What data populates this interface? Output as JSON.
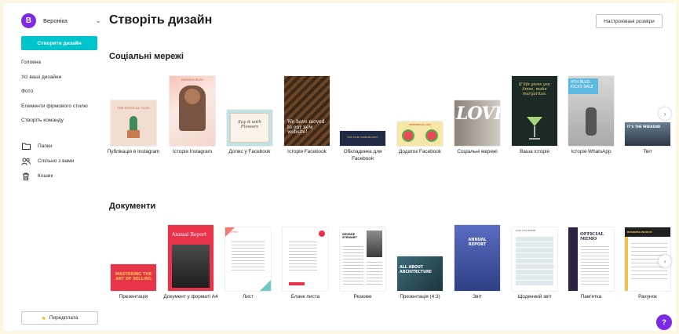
{
  "sidebar": {
    "avatar_letter": "В",
    "user_name": "Вероніка",
    "create_label": "Створити дизайн",
    "nav": [
      "Головна",
      "Усі ваші дизайни",
      "Фото",
      "Елементи фірмового стилю",
      "Створіть команду"
    ],
    "nav2": [
      {
        "label": "Папки",
        "icon": "folder-icon"
      },
      {
        "label": "Спільно з вами",
        "icon": "shared-users-icon"
      },
      {
        "label": "Кошик",
        "icon": "trash-icon"
      }
    ],
    "subscribe_label": "Передплата"
  },
  "header": {
    "title": "Створіть дизайн",
    "custom_size_label": "Настроювані розміри"
  },
  "social": {
    "title": "Соціальні мережі",
    "items": [
      {
        "label": "Публікація в Instagram",
        "thumb_text": "THE MYSTICAL OASIS"
      },
      {
        "label": "Історія Instagram",
        "thumb_text": "FASHION BLOG"
      },
      {
        "label": "Допис у Facebook",
        "thumb_text": "Say it with Flowers"
      },
      {
        "label": "Історія Facebook",
        "thumb_text": "We have moved to our new website!"
      },
      {
        "label": "Обкладинка для Facebook",
        "thumb_text": "HIGH STAKE GAMBLING PARTY"
      },
      {
        "label": "Додаток Facebook",
        "thumb_text": "WATERMELON CAKE"
      },
      {
        "label": "Соціальні мережі",
        "thumb_text": "LOVE"
      },
      {
        "label": "Ваша історія",
        "thumb_text": "If life gives you limes, make margaritas."
      },
      {
        "label": "Історія WhatsApp",
        "thumb_text": "4TH BLVD. KICKS SALE"
      },
      {
        "label": "Твіт",
        "thumb_text": "IT'S THE WEEKEND"
      }
    ]
  },
  "docs": {
    "title": "Документи",
    "items": [
      {
        "label": "Презентація",
        "thumb_text": "MASTERING THE ART OF SELLING"
      },
      {
        "label": "Документ у форматі A4",
        "thumb_text": "Annual Report"
      },
      {
        "label": "Лист",
        "thumb_text": "LETTER"
      },
      {
        "label": "Бланк листа",
        "thumb_text": ""
      },
      {
        "label": "Резюме",
        "thumb_text": "GEORGE STEWART"
      },
      {
        "label": "Презентація (4:3)",
        "thumb_text": "ALL ABOUT ARCHITECTURE"
      },
      {
        "label": "Звіт",
        "thumb_text": "ANNUAL REPORT"
      },
      {
        "label": "Щоденний звіт",
        "thumb_text": "DAILY TASK REPORT"
      },
      {
        "label": "Пам'ятка",
        "thumb_text": "OFFICIAL MEMO"
      },
      {
        "label": "Рахунок",
        "thumb_text": "BUSINESS INVOICE"
      }
    ]
  },
  "help_label": "?",
  "colors": {
    "brand": "#7d2ae8",
    "accent": "#00c4cc"
  }
}
